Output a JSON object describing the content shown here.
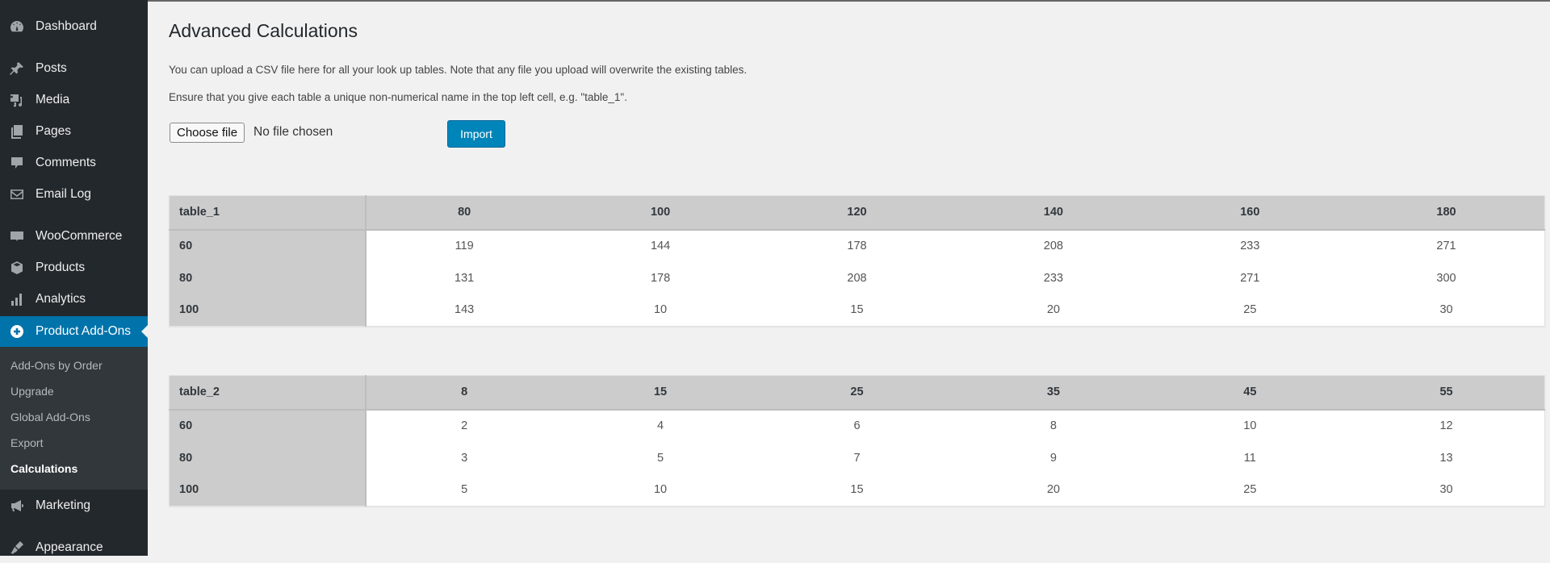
{
  "sidebar": {
    "items": [
      {
        "label": "Dashboard",
        "icon": "dashboard-icon"
      },
      {
        "label": "Posts",
        "icon": "pin-icon"
      },
      {
        "label": "Media",
        "icon": "media-icon"
      },
      {
        "label": "Pages",
        "icon": "pages-icon"
      },
      {
        "label": "Comments",
        "icon": "comment-icon"
      },
      {
        "label": "Email Log",
        "icon": "envelope-icon"
      },
      {
        "label": "WooCommerce",
        "icon": "woocommerce-icon"
      },
      {
        "label": "Products",
        "icon": "box-icon"
      },
      {
        "label": "Analytics",
        "icon": "bar-chart-icon"
      },
      {
        "label": "Product Add-Ons",
        "icon": "plus-circle-icon",
        "active": true
      },
      {
        "label": "Marketing",
        "icon": "megaphone-icon"
      },
      {
        "label": "Appearance",
        "icon": "paintbrush-icon"
      }
    ],
    "submenu": [
      {
        "label": "Add-Ons by Order"
      },
      {
        "label": "Upgrade"
      },
      {
        "label": "Global Add-Ons"
      },
      {
        "label": "Export"
      },
      {
        "label": "Calculations",
        "current": true
      }
    ],
    "active_color": "#0073aa"
  },
  "page": {
    "title": "Advanced Calculations",
    "intro": "You can upload a CSV file here for all your look up tables. Note that any file you upload will overwrite the existing tables.",
    "note": "Ensure that you give each table a unique non-numerical name in the top left cell, e.g. \"table_1\".",
    "file_button": "Choose file",
    "file_status": "No file chosen",
    "import_button": "Import"
  },
  "tables": [
    {
      "name": "table_1",
      "columns": [
        "80",
        "100",
        "120",
        "140",
        "160",
        "180"
      ],
      "rows": [
        {
          "label": "60",
          "values": [
            "119",
            "144",
            "178",
            "208",
            "233",
            "271"
          ]
        },
        {
          "label": "80",
          "values": [
            "131",
            "178",
            "208",
            "233",
            "271",
            "300"
          ]
        },
        {
          "label": "100",
          "values": [
            "143",
            "10",
            "15",
            "20",
            "25",
            "30"
          ]
        }
      ]
    },
    {
      "name": "table_2",
      "columns": [
        "8",
        "15",
        "25",
        "35",
        "45",
        "55"
      ],
      "rows": [
        {
          "label": "60",
          "values": [
            "2",
            "4",
            "6",
            "8",
            "10",
            "12"
          ]
        },
        {
          "label": "80",
          "values": [
            "3",
            "5",
            "7",
            "9",
            "11",
            "13"
          ]
        },
        {
          "label": "100",
          "values": [
            "5",
            "10",
            "15",
            "20",
            "25",
            "30"
          ]
        }
      ]
    }
  ]
}
